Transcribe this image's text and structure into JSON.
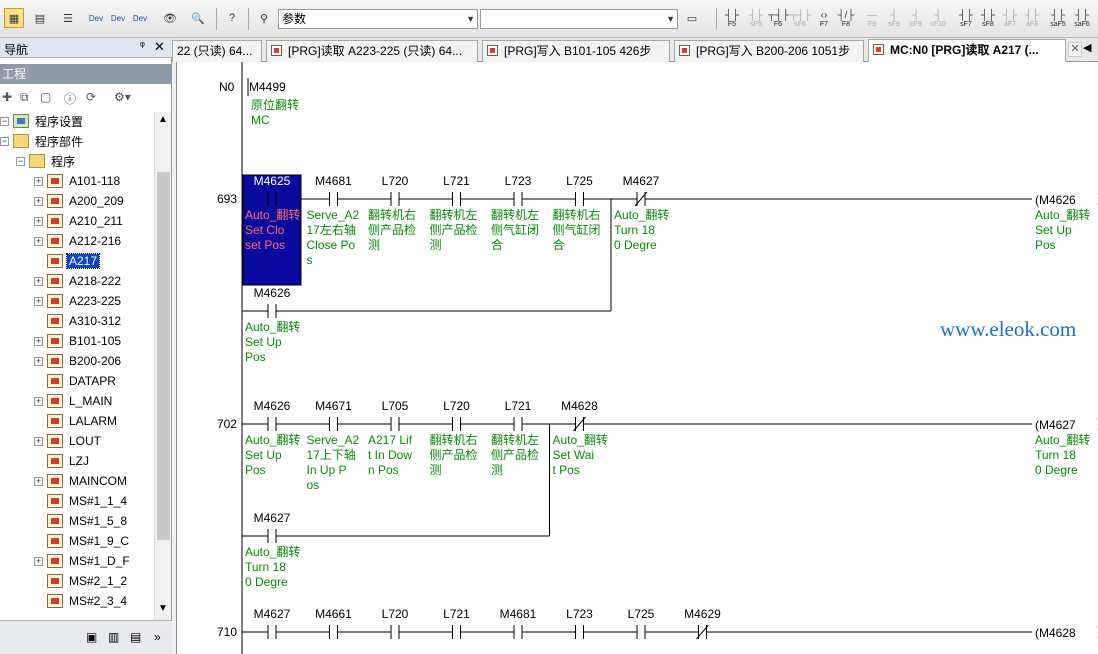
{
  "toolbar": {
    "param_combo": "参数",
    "fkeys": [
      {
        "label": "F5"
      },
      {
        "label": "sF5"
      },
      {
        "label": "F6"
      },
      {
        "label": "sF6"
      },
      {
        "label": "F7"
      },
      {
        "label": "F8"
      },
      {
        "label": "F9"
      },
      {
        "label": "sF9"
      },
      {
        "label": "cF9"
      },
      {
        "label": "cF10"
      },
      {
        "label": "sF7"
      },
      {
        "label": "sF8"
      },
      {
        "label": "aF7"
      },
      {
        "label": "aF8"
      },
      {
        "label": "saF5"
      },
      {
        "label": "saF6"
      }
    ],
    "dev_buttons": [
      "Dev",
      "Dev",
      "Dev"
    ]
  },
  "nav": {
    "title": "导航",
    "pin": "ᵠ",
    "close": "✕",
    "section": "工程",
    "tree": [
      {
        "label": "程序设置",
        "icon": "settings"
      },
      {
        "label": "程序部件",
        "icon": "folder"
      },
      {
        "label": "程序",
        "icon": "folder"
      },
      {
        "label": "A101-118",
        "expandable": true
      },
      {
        "label": "A200_209",
        "expandable": true
      },
      {
        "label": "A210_211",
        "expandable": true
      },
      {
        "label": "A212-216",
        "expandable": true
      },
      {
        "label": "A217",
        "expandable": false,
        "selected": true
      },
      {
        "label": "A218-222",
        "expandable": true
      },
      {
        "label": "A223-225",
        "expandable": true
      },
      {
        "label": "A310-312",
        "expandable": false
      },
      {
        "label": "B101-105",
        "expandable": true
      },
      {
        "label": "B200-206",
        "expandable": true
      },
      {
        "label": "DATAPR",
        "expandable": false
      },
      {
        "label": "L_MAIN",
        "expandable": true
      },
      {
        "label": "LALARM",
        "expandable": false
      },
      {
        "label": "LOUT",
        "expandable": true
      },
      {
        "label": "LZJ",
        "expandable": false
      },
      {
        "label": "MAINCOM",
        "expandable": true
      },
      {
        "label": "MS#1_1_4",
        "expandable": false
      },
      {
        "label": "MS#1_5_8",
        "expandable": false
      },
      {
        "label": "MS#1_9_C",
        "expandable": false
      },
      {
        "label": "MS#1_D_F",
        "expandable": true
      },
      {
        "label": "MS#2_1_2",
        "expandable": false
      },
      {
        "label": "MS#2_3_4",
        "expandable": false
      }
    ]
  },
  "tabs": [
    {
      "label": "22 (只读) 64..."
    },
    {
      "label": "[PRG]读取 A223-225 (只读) 64..."
    },
    {
      "label": "[PRG]写入 B101-105 426步"
    },
    {
      "label": "[PRG]写入 B200-206 1051步"
    },
    {
      "label": "MC:N0 [PRG]读取 A217 (..."
    }
  ],
  "watermark": "www.eleok.com",
  "ladder": {
    "n0": {
      "label": "N0",
      "device": "M4499",
      "comment": [
        "原位翻转",
        "MC"
      ]
    },
    "rungs": [
      {
        "step": "693",
        "contacts": [
          {
            "device": "M4625",
            "comment": [
              "Auto_翻转",
              "Set Clo",
              "set Pos"
            ],
            "selected": true
          },
          {
            "device": "M4681",
            "comment": [
              "Serve_A2",
              "17左右轴",
              "Close Po",
              "s"
            ]
          },
          {
            "device": "L720",
            "comment": [
              "翻转机右",
              "侧产品检",
              "测"
            ]
          },
          {
            "device": "L721",
            "comment": [
              "翻转机左",
              "侧产品检",
              "测"
            ]
          },
          {
            "device": "L723",
            "comment": [
              "翻转机左",
              "侧气缸闭",
              "合"
            ]
          },
          {
            "device": "L725",
            "comment": [
              "翻转机右",
              "侧气缸闭",
              "合"
            ]
          },
          {
            "device": "M4627",
            "comment": [
              "Auto_翻转",
              "Turn 18",
              "0 Degre"
            ],
            "nc": true
          }
        ],
        "branch": {
          "device": "M4626",
          "comment": [
            "Auto_翻转",
            "Set Up",
            "Pos"
          ]
        },
        "coil": {
          "device": "M4626",
          "comment": [
            "Auto_翻转",
            "Set Up",
            "Pos"
          ]
        }
      },
      {
        "step": "702",
        "contacts": [
          {
            "device": "M4626",
            "comment": [
              "Auto_翻转",
              "Set Up",
              "Pos"
            ]
          },
          {
            "device": "M4671",
            "comment": [
              "Serve_A2",
              "17上下轴",
              "In Up P",
              "os"
            ]
          },
          {
            "device": "L705",
            "comment": [
              "A217 Lif",
              "t In Dow",
              "n Pos"
            ]
          },
          {
            "device": "L720",
            "comment": [
              "翻转机右",
              "侧产品检",
              "测"
            ]
          },
          {
            "device": "L721",
            "comment": [
              "翻转机左",
              "侧产品检",
              "测"
            ]
          },
          {
            "device": "M4628",
            "comment": [
              "Auto_翻转",
              "Set Wai",
              "t Pos"
            ],
            "nc": true
          }
        ],
        "branch": {
          "device": "M4627",
          "comment": [
            "Auto_翻转",
            "Turn 18",
            "0 Degre"
          ]
        },
        "coil": {
          "device": "M4627",
          "comment": [
            "Auto_翻转",
            "Turn 18",
            "0 Degre"
          ]
        }
      },
      {
        "step": "710",
        "contacts": [
          {
            "device": "M4627"
          },
          {
            "device": "M4661"
          },
          {
            "device": "L720"
          },
          {
            "device": "L721"
          },
          {
            "device": "M4681"
          },
          {
            "device": "L723"
          },
          {
            "device": "L725"
          },
          {
            "device": "M4629",
            "nc": true
          }
        ],
        "coil": {
          "device": "M4628"
        }
      }
    ]
  }
}
